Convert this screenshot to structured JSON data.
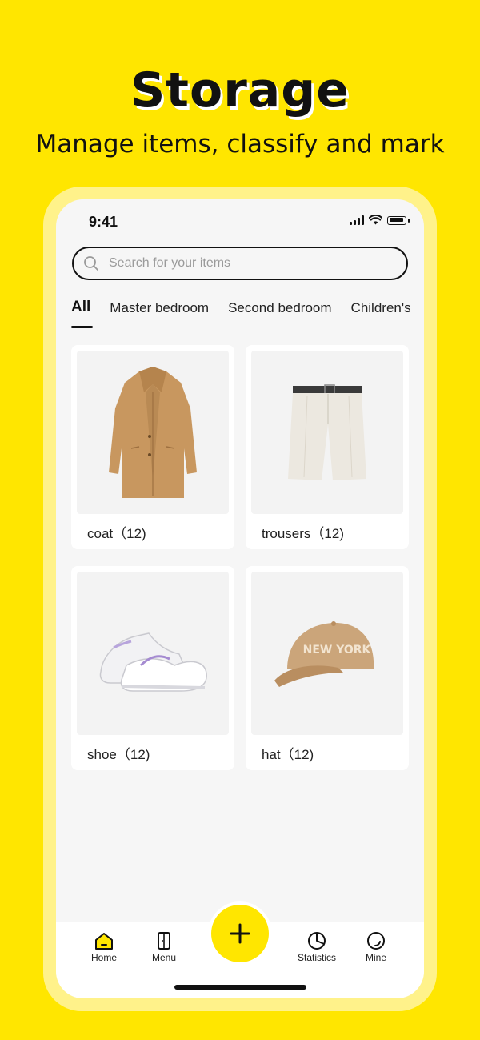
{
  "promo": {
    "title": "Storage",
    "subtitle": "Manage items, classify and mark"
  },
  "status_bar": {
    "time": "9:41"
  },
  "search": {
    "placeholder": "Search for your items",
    "value": ""
  },
  "tabs": [
    {
      "label": "All",
      "active": true
    },
    {
      "label": "Master bedroom",
      "active": false
    },
    {
      "label": "Second bedroom",
      "active": false
    },
    {
      "label": "Children's",
      "active": false
    }
  ],
  "items": [
    {
      "label": "coat（12)",
      "icon": "coat-image"
    },
    {
      "label": "trousers（12)",
      "icon": "shorts-image"
    },
    {
      "label": "shoe（12)",
      "icon": "sneakers-image"
    },
    {
      "label": "hat（12)",
      "icon": "cap-image",
      "print": "NEW YORK"
    }
  ],
  "tabbar": {
    "home": "Home",
    "menu": "Menu",
    "statistics": "Statistics",
    "mine": "Mine"
  },
  "colors": {
    "accent": "#FFE600",
    "text": "#111111"
  }
}
